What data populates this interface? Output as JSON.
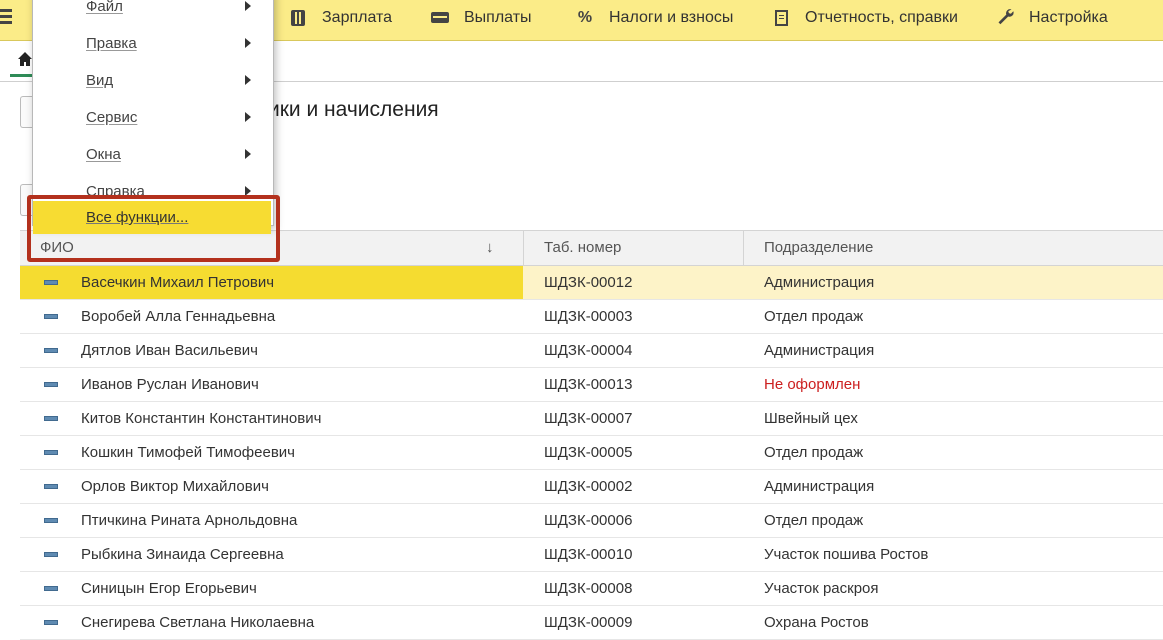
{
  "topbar": {
    "items": [
      {
        "label": "Зарплата",
        "icon": "calculator-icon"
      },
      {
        "label": "Выплаты",
        "icon": "wallet-icon"
      },
      {
        "label": "Налоги и взносы",
        "icon": "percent-icon"
      },
      {
        "label": "Отчетность, справки",
        "icon": "report-icon"
      },
      {
        "label": "Настройка",
        "icon": "wrench-icon"
      }
    ]
  },
  "page": {
    "title_visible": "ики и начисления"
  },
  "menu": {
    "items": [
      {
        "label": "Файл"
      },
      {
        "label": "Правка"
      },
      {
        "label": "Вид"
      },
      {
        "label": "Сервис"
      },
      {
        "label": "Окна"
      },
      {
        "label": "Справка"
      }
    ],
    "all_functions": "Все функции..."
  },
  "table": {
    "headers": {
      "name": "ФИО",
      "tab_number": "Таб. номер",
      "department": "Подразделение"
    },
    "sort_indicator": "↓",
    "rows": [
      {
        "name": "Васечкин Михаил Петрович",
        "tab": "ШДЗК-00012",
        "dept": "Администрация"
      },
      {
        "name": "Воробей Алла Геннадьевна",
        "tab": "ШДЗК-00003",
        "dept": "Отдел продаж"
      },
      {
        "name": "Дятлов Иван Васильевич",
        "tab": "ШДЗК-00004",
        "dept": "Администрация"
      },
      {
        "name": "Иванов Руслан Иванович",
        "tab": "ШДЗК-00013",
        "dept": "Не оформлен"
      },
      {
        "name": "Китов Константин Константинович",
        "tab": "ШДЗК-00007",
        "dept": "Швейный цех"
      },
      {
        "name": "Кошкин Тимофей Тимофеевич",
        "tab": "ШДЗК-00005",
        "dept": "Отдел продаж"
      },
      {
        "name": "Орлов Виктор Михайлович",
        "tab": "ШДЗК-00002",
        "dept": "Администрация"
      },
      {
        "name": "Птичкина Рината Арнольдовна",
        "tab": "ШДЗК-00006",
        "dept": "Отдел продаж"
      },
      {
        "name": "Рыбкина Зинаида Сергеевна",
        "tab": "ШДЗК-00010",
        "dept": "Участок пошива Ростов"
      },
      {
        "name": "Синицын Егор Егорьевич",
        "tab": "ШДЗК-00008",
        "dept": "Участок раскроя"
      },
      {
        "name": "Снегирева Светлана Николаевна",
        "tab": "ШДЗК-00009",
        "dept": "Охрана Ростов"
      }
    ]
  },
  "colors": {
    "topbar": "#fbec88",
    "selection": "#f5dc30",
    "highlight_frame": "#b3311d",
    "status_red": "#cc1f1f"
  }
}
